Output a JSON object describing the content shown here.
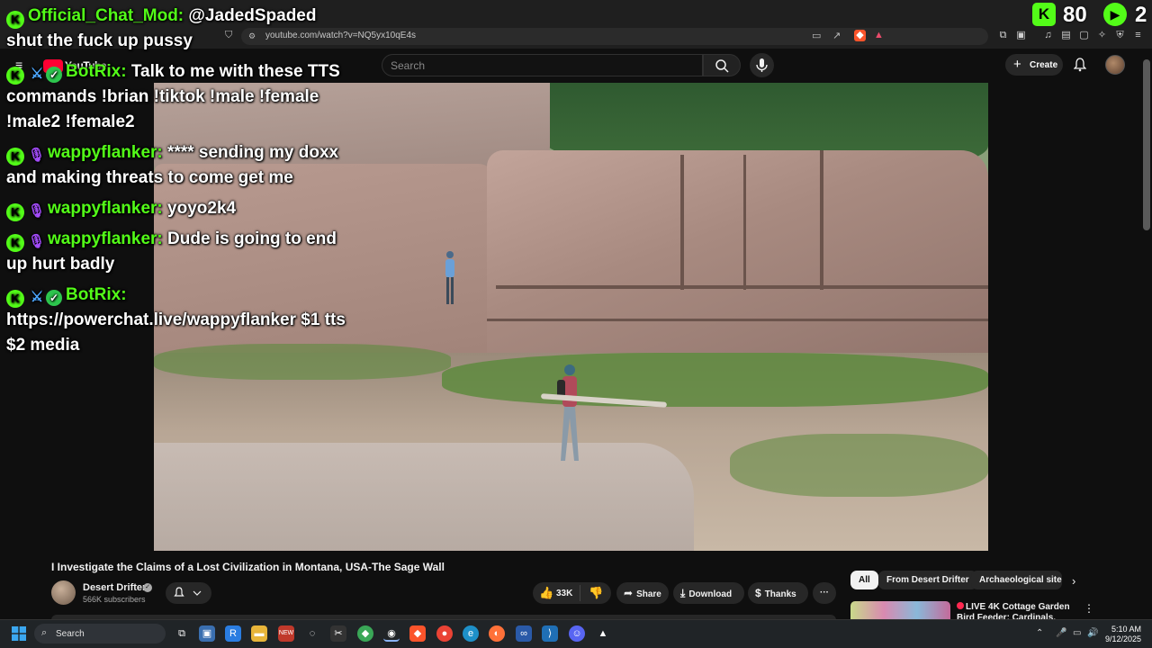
{
  "browser": {
    "url": "youtube.com/watch?v=NQ5yx10qE4s"
  },
  "youtube": {
    "logo_text": "YouTube",
    "search_placeholder": "Search",
    "create_label": "Create"
  },
  "chat": {
    "messages": [
      {
        "user": "Official_Chat_Mod:",
        "text": " @JadedSpaded"
      },
      {
        "user": "",
        "text": "shut the fuck up pussy"
      },
      {
        "user": "BotRix:",
        "text": " Talk to me with these TTS commands !brian !tiktok !male !female !male2 !female2"
      },
      {
        "user": "wappyflanker:",
        "text": " **** sending my doxx and making threats to come get me"
      },
      {
        "user": "wappyflanker:",
        "text": " yoyo2k4"
      },
      {
        "user": "wappyflanker:",
        "text": " Dude is going to end up hurt badly"
      },
      {
        "user": "BotRix:",
        "text": ""
      },
      {
        "user": "",
        "text": "https://powerchat.live/wappyflanker $1 tts $2 media"
      }
    ],
    "viewer_count": "80",
    "second_count": "2"
  },
  "video": {
    "title": "I Investigate the Claims of a Lost Civilization in Montana, USA-The Sage Wall",
    "channel": "Desert Drifter",
    "subscribers": "566K subscribers",
    "likes": "33K",
    "share_label": "Share",
    "download_label": "Download",
    "thanks_label": "Thanks",
    "more_label": "···"
  },
  "chips": {
    "all": "All",
    "from_channel": "From Desert Drifter",
    "archaeological": "Archaeological sites"
  },
  "recommendation": {
    "title": "LIVE 4K Cottage Garden Bird Feeder: Cardinals,"
  },
  "taskbar": {
    "search_label": "Search",
    "time": "5:10 AM",
    "date": "9/12/2025"
  },
  "colors": {
    "kick_green": "#53fc18",
    "yt_red": "#ff0033",
    "live_red": "#ff2850",
    "bot_blue": "#4da8ff",
    "mic_purple": "#a64dff"
  }
}
